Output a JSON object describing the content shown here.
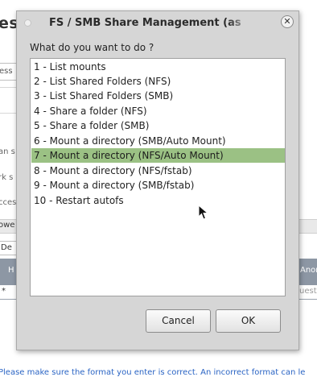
{
  "background": {
    "title_fragment": "ess",
    "input_fragment": "ess",
    "side_texts": [
      "an s",
      "rk s",
      "cces"
    ],
    "strip_label": "owe",
    "input2_value": "De",
    "header_left": "H",
    "header_right": "Anon",
    "row_star": "*",
    "row_guest": "uest",
    "notice": "Please make sure the format you enter is correct. An incorrect format can le"
  },
  "dialog": {
    "title": "FS / SMB Share Management (as",
    "close_symbol": "✕",
    "prompt": "What do you want to do ?",
    "options": [
      "1 - List mounts",
      "2 - List Shared Folders (NFS)",
      "3 - List Shared Folders (SMB)",
      "4 - Share a folder (NFS)",
      "5 - Share a folder (SMB)",
      "6 - Mount a directory (SMB/Auto Mount)",
      "7 - Mount a directory (NFS/Auto Mount)",
      "8 - Mount a directory (NFS/fstab)",
      "9 - Mount a directory (SMB/fstab)",
      "10 - Restart autofs"
    ],
    "selected_index": 6,
    "selected_color": "#9bc184",
    "cancel_label": "Cancel",
    "ok_label": "OK"
  },
  "icons": {
    "title": "window-dot-icon",
    "close": "close-icon",
    "pointer": "mouse-pointer-icon"
  }
}
